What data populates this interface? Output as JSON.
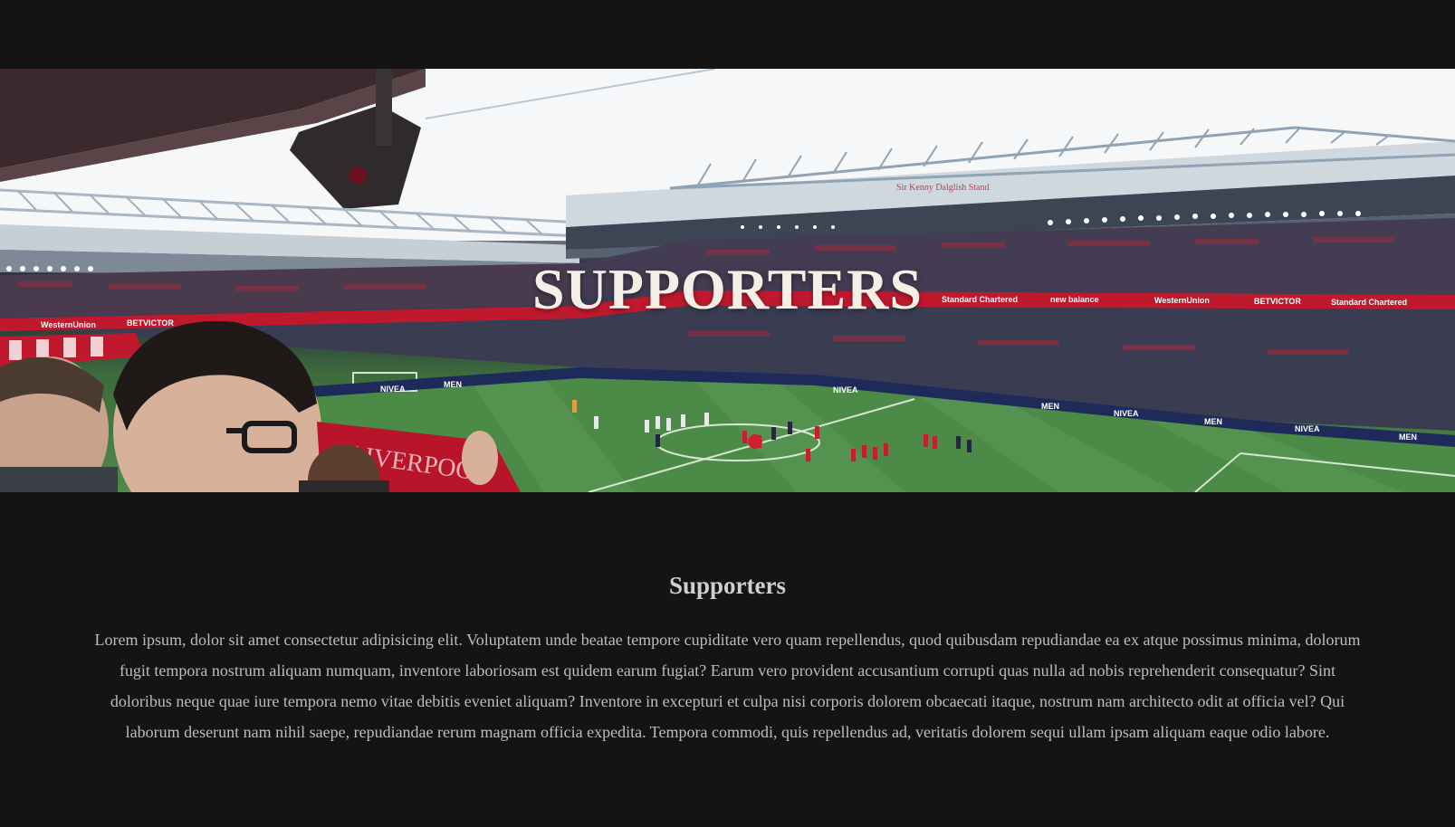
{
  "hero": {
    "title": "SUPPORTERS",
    "image_description_icon": "stadium-photo",
    "banner_texts": [
      "Standard Chartered",
      "new balance",
      "WesternUnion",
      "BETVICTOR",
      "Standard Chartered",
      "Sir Kenny Dalglish Stand"
    ],
    "pitch_board_texts": [
      "NIVEA",
      "MEN",
      "NIVEA",
      "MEN",
      "NIVEA",
      "MEN",
      "NIVEA",
      "MEN"
    ],
    "scarf_text": "LIVERPOOL"
  },
  "section": {
    "title": "Supporters",
    "body": "Lorem ipsum, dolor sit amet consectetur adipisicing elit. Voluptatem unde beatae tempore cupiditate vero quam repellendus, quod quibusdam repudiandae ea ex atque possimus minima, dolorum fugit tempora nostrum aliquam numquam, inventore laboriosam est quidem earum fugiat? Earum vero provident accusantium corrupti quas nulla ad nobis reprehenderit consequatur? Sint doloribus neque quae iure tempora nemo vitae debitis eveniet aliquam? Inventore in excepturi et culpa nisi corporis dolorem obcaecati itaque, nostrum nam architecto odit at officia vel? Qui laborum deserunt nam nihil saepe, repudiandae rerum magnam officia expedita. Tempora commodi, quis repellendus ad, veritatis dolorem sequi ullam ipsam aliquam eaque odio labore."
  },
  "colors": {
    "background": "#141414",
    "hero_title": "#f3efe6",
    "section_title": "#cfcfcf",
    "body_text": "#bdbdbd",
    "pitch_green": "#4e8a4a",
    "banner_red": "#c0192e"
  }
}
